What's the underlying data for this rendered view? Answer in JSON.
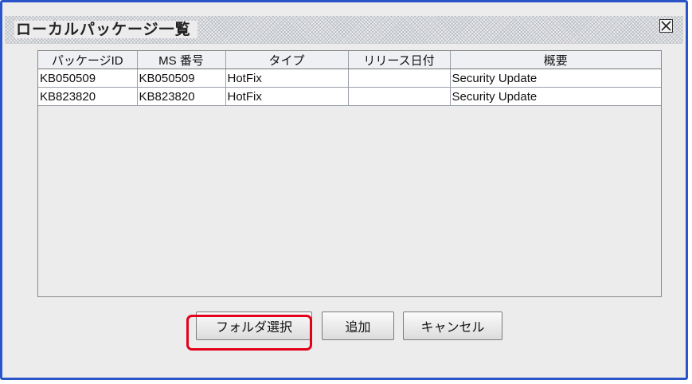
{
  "dialog": {
    "title": "ローカルパッケージ一覧",
    "close_icon": "close-icon",
    "border_color": "#2a55c9"
  },
  "table": {
    "columns": [
      "パッケージID",
      "MS 番号",
      "タイプ",
      "リリース日付",
      "概要"
    ],
    "rows": [
      [
        "KB050509",
        "KB050509",
        "HotFix",
        "",
        "Security Update"
      ],
      [
        "KB823820",
        "KB823820",
        "HotFix",
        "",
        "Security Update"
      ]
    ]
  },
  "buttons": {
    "folder_select": "フォルダ選択",
    "add": "追加",
    "cancel": "キャンセル"
  },
  "highlight_color": "#e3001b"
}
